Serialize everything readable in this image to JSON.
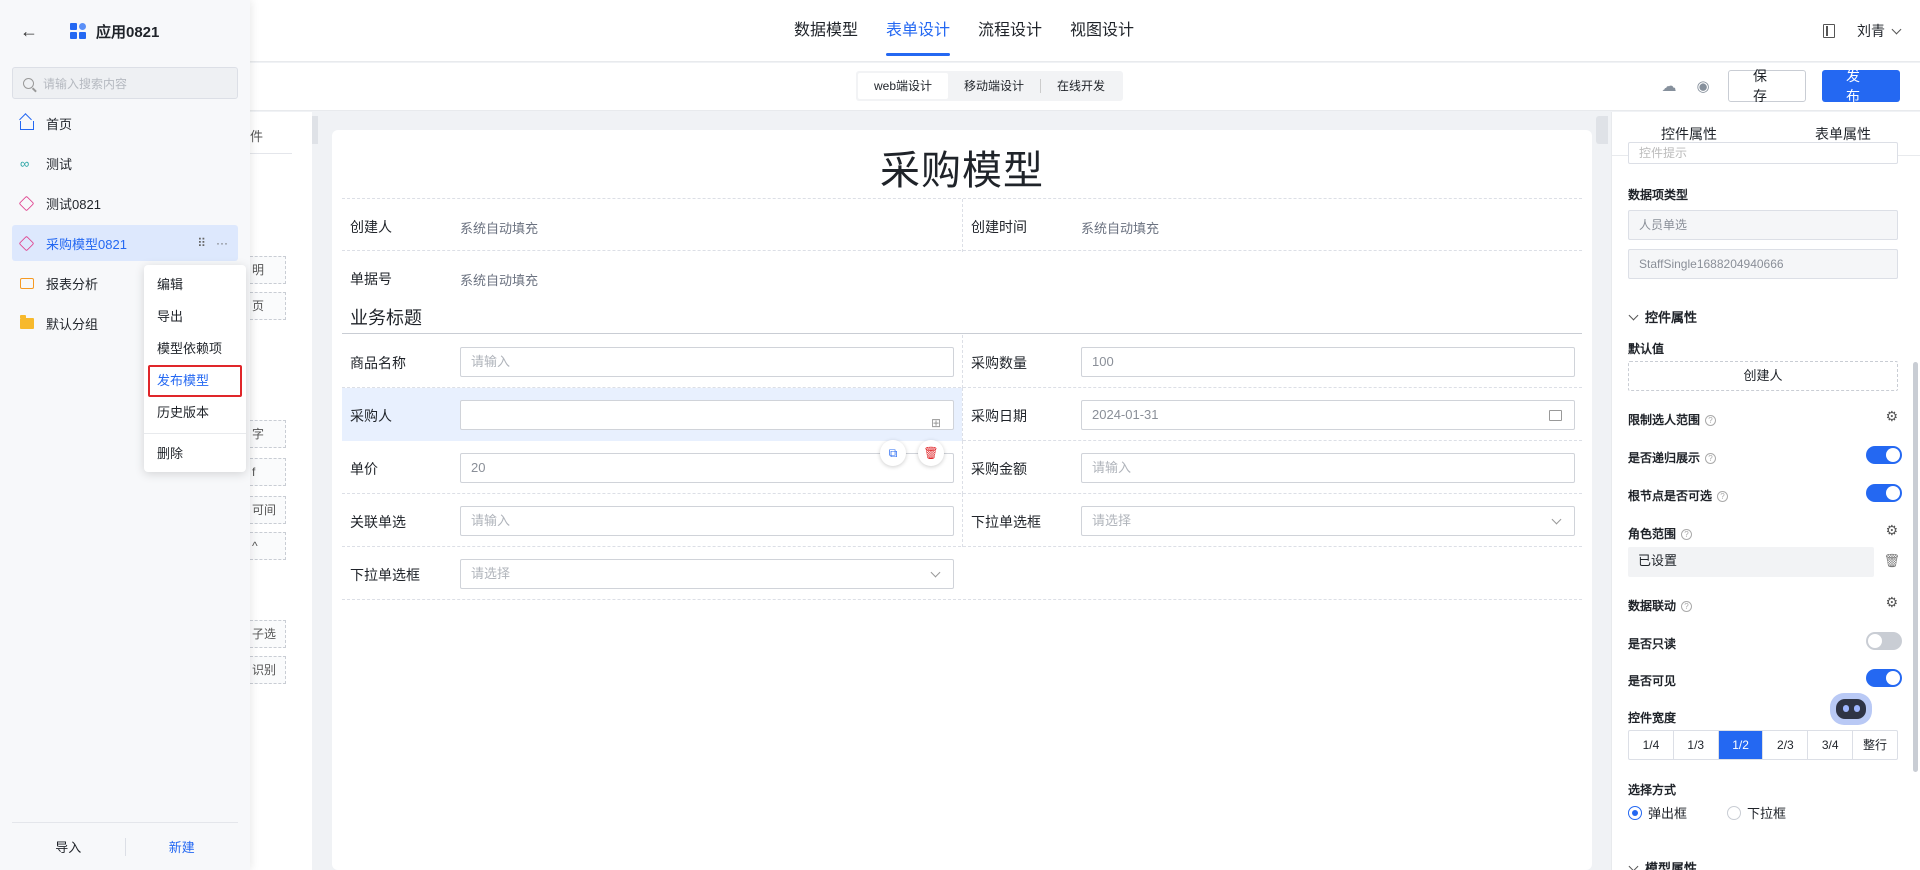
{
  "header": {
    "tabs": [
      "数据模型",
      "表单设计",
      "流程设计",
      "视图设计"
    ],
    "active_tab": "表单设计",
    "user": "刘青"
  },
  "toolbar": {
    "modes": [
      "web端设计",
      "移动端设计",
      "在线开发"
    ],
    "save_label": "保 存",
    "publish_label": "发 布"
  },
  "left_panel": {
    "app_title": "应用0821",
    "search_placeholder": "请输入搜索内容",
    "items": [
      {
        "label": "首页",
        "icon": "home-icon"
      },
      {
        "label": "测试",
        "icon": "link-icon"
      },
      {
        "label": "测试0821",
        "icon": "cube-icon"
      },
      {
        "label": "采购模型0821",
        "icon": "cube-icon",
        "active": true
      },
      {
        "label": "报表分析",
        "icon": "chart-icon"
      },
      {
        "label": "默认分组",
        "icon": "folder-icon"
      }
    ],
    "footer_import": "导入",
    "footer_new": "新建"
  },
  "context_menu": {
    "items": [
      "编辑",
      "导出",
      "模型依赖项",
      "发布模型",
      "历史版本"
    ],
    "highlighted": "发布模型",
    "delete": "删除"
  },
  "behind_strip": {
    "chips": [
      "件",
      "明",
      "页",
      "字",
      "f",
      "可间",
      "^",
      "子选",
      "识别"
    ]
  },
  "form": {
    "title": "采购模型",
    "creator_label": "创建人",
    "creator_value": "系统自动填充",
    "created_time_label": "创建时间",
    "created_time_value": "系统自动填充",
    "doc_no_label": "单据号",
    "doc_no_value": "系统自动填充",
    "section_title": "业务标题",
    "product_label": "商品名称",
    "product_placeholder": "请输入",
    "qty_label": "采购数量",
    "qty_value": "100",
    "buyer_label": "采购人",
    "date_label": "采购日期",
    "date_value": "2024-01-31",
    "price_label": "单价",
    "price_value": "20",
    "amount_label": "采购金额",
    "amount_placeholder": "请输入",
    "relation_label": "关联单选",
    "relation_placeholder": "请输入",
    "dropdown1_label": "下拉单选框",
    "dropdown1_placeholder": "请选择",
    "dropdown2_label": "下拉单选框",
    "dropdown2_placeholder": "请选择"
  },
  "right_panel": {
    "tab_control": "控件属性",
    "tab_form": "表单属性",
    "top_cut_text": "控件提示",
    "data_type_label": "数据项类型",
    "data_type_value": "人员单选",
    "field_id": "StaffSingle1688204940666",
    "section_label": "控件属性",
    "default_label": "默认值",
    "default_value": "创建人",
    "limit_label": "限制选人范围",
    "recursive_label": "是否递归展示",
    "root_label": "根节点是否可选",
    "role_label": "角色范围",
    "role_value": "已设置",
    "linkage_label": "数据联动",
    "readonly_label": "是否只读",
    "visible_label": "是否可见",
    "width_label": "控件宽度",
    "width_options": [
      "1/4",
      "1/3",
      "1/2",
      "2/3",
      "3/4",
      "整行"
    ],
    "width_selected": "1/2",
    "select_mode_label": "选择方式",
    "select_mode_options": [
      "弹出框",
      "下拉框"
    ],
    "model_section_label": "模型属性",
    "toggles": {
      "recursive": true,
      "root": true,
      "readonly": false,
      "visible": true
    }
  }
}
